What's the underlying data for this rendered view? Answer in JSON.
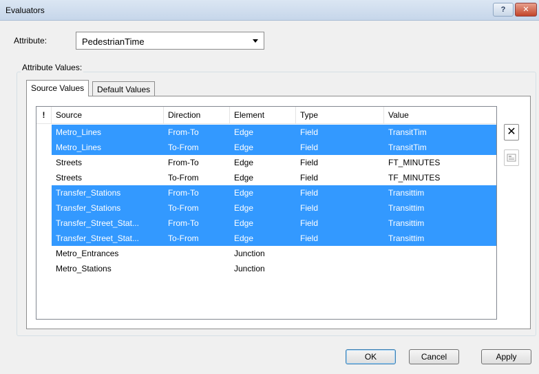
{
  "window": {
    "title": "Evaluators",
    "help_label": "?",
    "close_label": "✕"
  },
  "attribute": {
    "label": "Attribute:",
    "selected_value": "PedestrianTime"
  },
  "attribute_values": {
    "group_label": "Attribute Values:"
  },
  "tabs": [
    {
      "label": "Source Values",
      "active": true
    },
    {
      "label": "Default Values",
      "active": false
    }
  ],
  "table": {
    "columns": [
      "!",
      "Source",
      "Direction",
      "Element",
      "Type",
      "Value"
    ],
    "rows": [
      {
        "source": "Metro_Lines",
        "direction": "From-To",
        "element": "Edge",
        "type": "Field",
        "value": "TransitTim",
        "selected": true
      },
      {
        "source": "Metro_Lines",
        "direction": "To-From",
        "element": "Edge",
        "type": "Field",
        "value": "TransitTim",
        "selected": true
      },
      {
        "source": "Streets",
        "direction": "From-To",
        "element": "Edge",
        "type": "Field",
        "value": "FT_MINUTES",
        "selected": false
      },
      {
        "source": "Streets",
        "direction": "To-From",
        "element": "Edge",
        "type": "Field",
        "value": "TF_MINUTES",
        "selected": false
      },
      {
        "source": "Transfer_Stations",
        "direction": "From-To",
        "element": "Edge",
        "type": "Field",
        "value": "Transittim",
        "selected": true
      },
      {
        "source": "Transfer_Stations",
        "direction": "To-From",
        "element": "Edge",
        "type": "Field",
        "value": "Transittim",
        "selected": true
      },
      {
        "source": "Transfer_Street_Stat...",
        "direction": "From-To",
        "element": "Edge",
        "type": "Field",
        "value": "Transittim",
        "selected": true
      },
      {
        "source": "Transfer_Street_Stat...",
        "direction": "To-From",
        "element": "Edge",
        "type": "Field",
        "value": "Transittim",
        "selected": true
      },
      {
        "source": "Metro_Entrances",
        "direction": "",
        "element": "Junction",
        "type": "",
        "value": "",
        "selected": false
      },
      {
        "source": "Metro_Stations",
        "direction": "",
        "element": "Junction",
        "type": "",
        "value": "",
        "selected": false
      }
    ]
  },
  "side_buttons": {
    "delete_icon": "close-x-icon",
    "properties_icon": "properties-icon"
  },
  "buttons": {
    "ok": "OK",
    "cancel": "Cancel",
    "apply": "Apply"
  },
  "colors": {
    "selection": "#3399ff",
    "close_button": "#c2452a"
  }
}
